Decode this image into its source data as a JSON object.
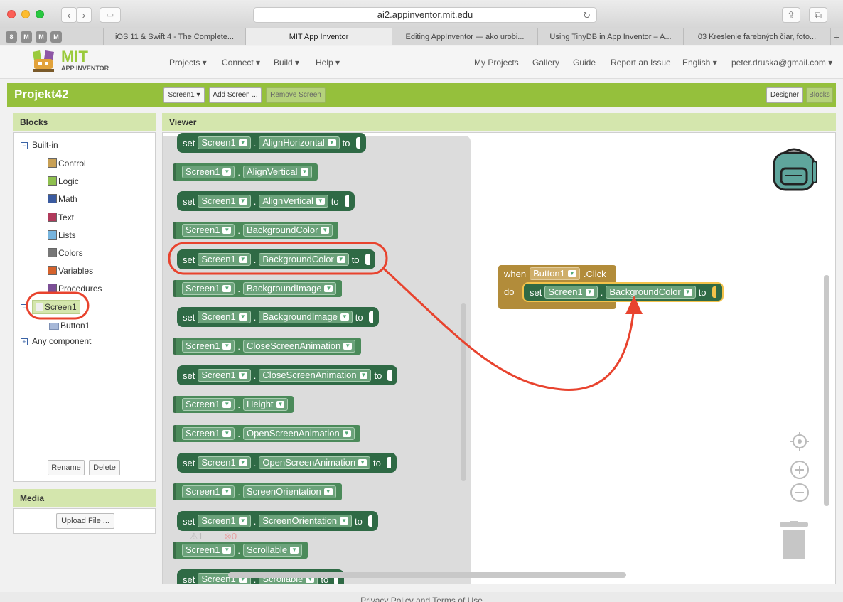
{
  "browser": {
    "url": "ai2.appinventor.mit.edu",
    "pinned_tabs": [
      "8",
      "M",
      "M",
      "M"
    ],
    "tabs": [
      "iOS 11 & Swift 4 - The Complete...",
      "MIT App Inventor",
      "Editing AppInventor — ako urobi...",
      "Using TinyDB in App Inventor – A...",
      "03 Kreslenie farebných čiar, foto..."
    ],
    "back_glyph": "‹",
    "forward_glyph": "›",
    "reload_glyph": "↻",
    "share_glyph": "⇪",
    "tabs_glyph": "⧉",
    "newtab_glyph": "+"
  },
  "header": {
    "logo_text": "MIT",
    "logo_sub": "APP INVENTOR",
    "menu": [
      "Projects ▾",
      "Connect ▾",
      "Build ▾",
      "Help ▾"
    ],
    "right_menu": [
      "My Projects",
      "Gallery",
      "Guide",
      "Report an Issue",
      "English ▾",
      "peter.druska@gmail.com ▾"
    ]
  },
  "project": {
    "name": "Projekt42",
    "screen_dropdown": "Screen1 ▾",
    "add_screen": "Add Screen ...",
    "remove_screen": "Remove Screen",
    "designer": "Designer",
    "blocks": "Blocks"
  },
  "blocks_panel": {
    "title": "Blocks",
    "builtin_label": "Built-in",
    "builtin": [
      {
        "label": "Control",
        "color": "#c8a055"
      },
      {
        "label": "Logic",
        "color": "#8fc04f"
      },
      {
        "label": "Math",
        "color": "#3b5ba0"
      },
      {
        "label": "Text",
        "color": "#b03a5b"
      },
      {
        "label": "Lists",
        "color": "#77b4dd"
      },
      {
        "label": "Colors",
        "color": "#777777"
      },
      {
        "label": "Variables",
        "color": "#d5622c"
      },
      {
        "label": "Procedures",
        "color": "#7b4f96"
      }
    ],
    "screen_label": "Screen1",
    "button_label": "Button1",
    "any_component": "Any component",
    "rename": "Rename",
    "delete": "Delete",
    "expand_minus": "−",
    "expand_plus": "+"
  },
  "media": {
    "title": "Media",
    "upload": "Upload File ..."
  },
  "viewer": {
    "title": "Viewer",
    "component": "Screen1",
    "dot": ".",
    "set_word": "set",
    "to_word": "to",
    "flyout_blocks": [
      {
        "kind": "set",
        "prop": "AlignHorizontal"
      },
      {
        "kind": "get",
        "prop": "AlignVertical"
      },
      {
        "kind": "set",
        "prop": "AlignVertical"
      },
      {
        "kind": "get",
        "prop": "BackgroundColor"
      },
      {
        "kind": "set",
        "prop": "BackgroundColor"
      },
      {
        "kind": "get",
        "prop": "BackgroundImage"
      },
      {
        "kind": "set",
        "prop": "BackgroundImage"
      },
      {
        "kind": "get",
        "prop": "CloseScreenAnimation"
      },
      {
        "kind": "set",
        "prop": "CloseScreenAnimation"
      },
      {
        "kind": "get",
        "prop": "Height"
      },
      {
        "kind": "get",
        "prop": "OpenScreenAnimation"
      },
      {
        "kind": "set",
        "prop": "OpenScreenAnimation"
      },
      {
        "kind": "get",
        "prop": "ScreenOrientation"
      },
      {
        "kind": "set",
        "prop": "ScreenOrientation"
      },
      {
        "kind": "get",
        "prop": "Scrollable"
      },
      {
        "kind": "set",
        "prop": "Scrollable"
      }
    ],
    "warnings": "⚠1",
    "errors": "⊗0",
    "event": {
      "when": "when",
      "component": "Button1",
      "event_name": ".Click",
      "do": "do",
      "set": "set",
      "target": "Screen1",
      "prop": "BackgroundColor",
      "to": "to"
    },
    "accent_color": "#e8432e"
  },
  "footer": "Privacy Policy and Terms of Use"
}
